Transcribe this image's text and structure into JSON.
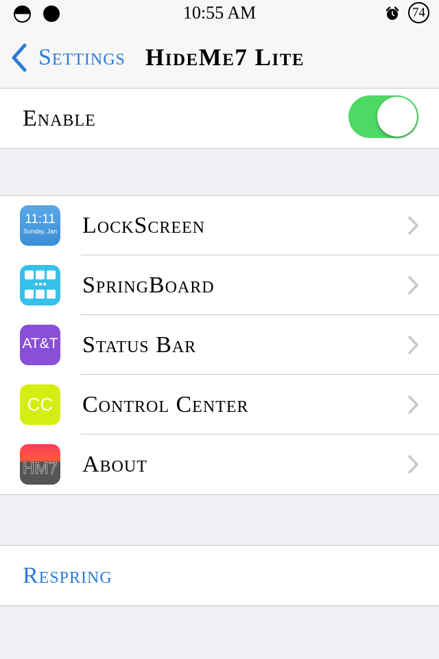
{
  "status_bar": {
    "time": "10:55 AM",
    "battery": "74",
    "alarm_icon": "alarm-clock-icon"
  },
  "nav": {
    "back_label": "Settings",
    "title": "HideMe7 Lite"
  },
  "enable": {
    "label": "Enable",
    "on": true
  },
  "menu": [
    {
      "label": "LockScreen",
      "icon": "lockscreen-icon",
      "icon_text": "11:11",
      "icon_subtext": "Sunday, Jan"
    },
    {
      "label": "SpringBoard",
      "icon": "springboard-icon"
    },
    {
      "label": "Status Bar",
      "icon": "status-bar-icon",
      "icon_text": "AT&T"
    },
    {
      "label": "Control Center",
      "icon": "control-center-icon",
      "icon_text": "CC"
    },
    {
      "label": "About",
      "icon": "about-icon",
      "icon_text": "HM7"
    }
  ],
  "respring": {
    "label": "Respring"
  },
  "colors": {
    "accent": "#2b7bd7",
    "switch_on": "#4cd964",
    "background": "#efeff4"
  }
}
